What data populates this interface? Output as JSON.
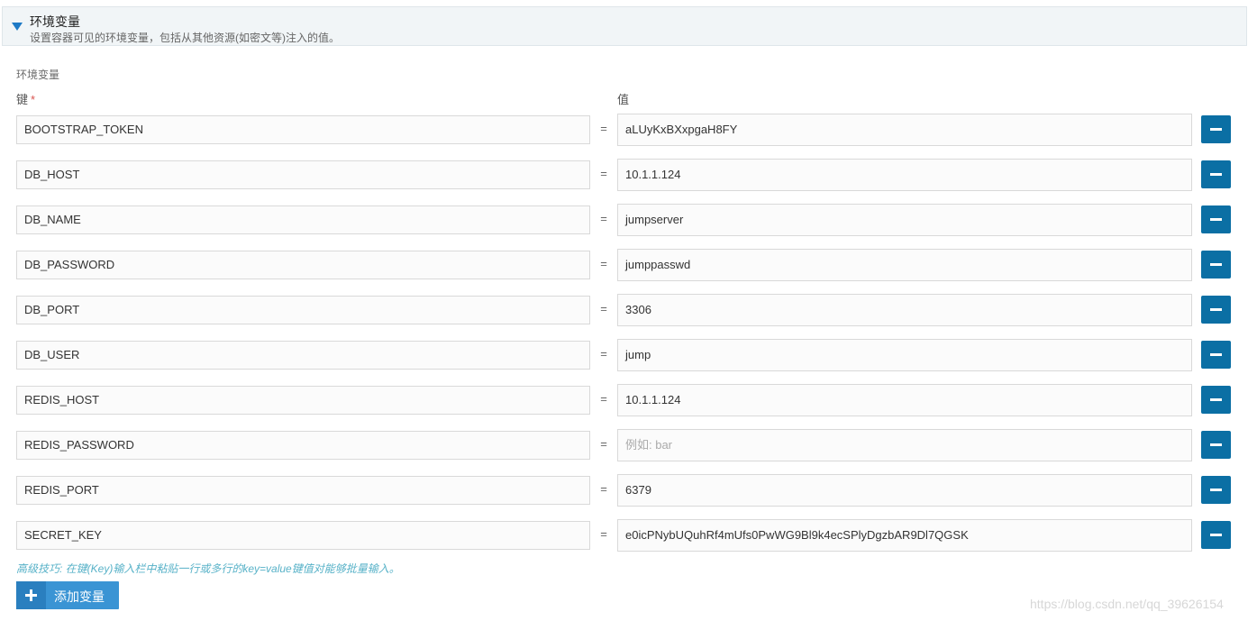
{
  "section": {
    "title": "环境变量",
    "subtitle": "设置容器可见的环境变量，包括从其他资源(如密文等)注入的值。"
  },
  "group_label": "环境变量",
  "columns": {
    "key": "键",
    "required_mark": "*",
    "value": "值"
  },
  "equals": "=",
  "rows": [
    {
      "key": "BOOTSTRAP_TOKEN",
      "value": "aLUyKxBXxpgaH8FY"
    },
    {
      "key": "DB_HOST",
      "value": "10.1.1.124"
    },
    {
      "key": "DB_NAME",
      "value": "jumpserver"
    },
    {
      "key": "DB_PASSWORD",
      "value": "jumppasswd"
    },
    {
      "key": "DB_PORT",
      "value": "3306"
    },
    {
      "key": "DB_USER",
      "value": "jump"
    },
    {
      "key": "REDIS_HOST",
      "value": "10.1.1.124"
    },
    {
      "key": "REDIS_PASSWORD",
      "value": "",
      "placeholder": "例如: bar"
    },
    {
      "key": "REDIS_PORT",
      "value": "6379"
    },
    {
      "key": "SECRET_KEY",
      "value": "e0icPNybUQuhRf4mUfs0PwWG9Bl9k4ecSPlyDgzbAR9Dl7QGSK"
    }
  ],
  "tip": "高级技巧: 在键(Key)输入栏中粘贴一行或多行的key=value键值对能够批量输入。",
  "add_button": {
    "label": "添加变量"
  },
  "watermark": "https://blog.csdn.net/qq_39626154",
  "colors": {
    "primary_button": "#0b6fa4",
    "add_button": "#3a94d4",
    "tip_text": "#58b2c8",
    "required": "#d9534f",
    "caret": "#1e7ac6"
  },
  "icons": {
    "toggle": "caret-down-icon",
    "remove": "minus-icon",
    "add": "plus-icon"
  }
}
